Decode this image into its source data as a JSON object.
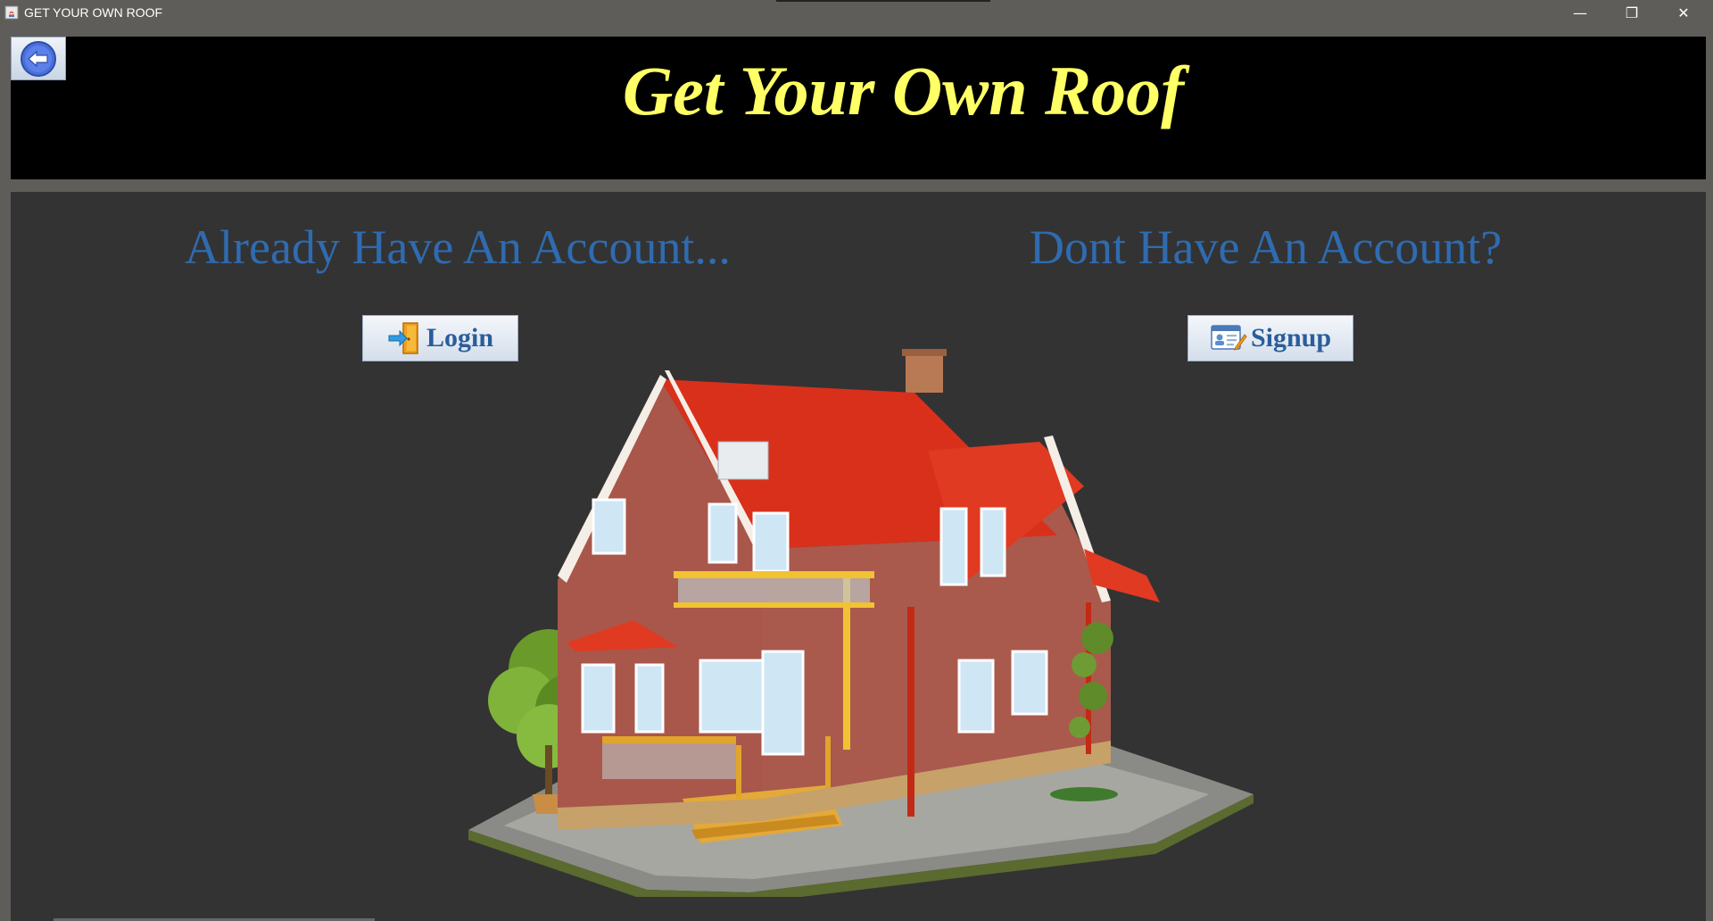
{
  "window": {
    "title": "GET YOUR OWN ROOF",
    "controls": {
      "minimize": "—",
      "maximize": "❐",
      "close": "✕"
    }
  },
  "header": {
    "back_icon": "back-arrow-icon",
    "title": "Get Your Own Roof"
  },
  "main": {
    "login_section": {
      "heading": "Already Have An Account...",
      "button_label": "Login",
      "button_icon": "door-enter-icon"
    },
    "signup_section": {
      "heading": "Dont Have An Account?",
      "button_label": "Signup",
      "button_icon": "id-card-edit-icon"
    },
    "image": "house-illustration"
  },
  "colors": {
    "header_bg": "#000000",
    "title_yellow": "#ffff66",
    "heading_blue": "#2f6bb0",
    "panel_bg": "#333333",
    "roof_red": "#d9301c",
    "brick": "#a8574a"
  }
}
